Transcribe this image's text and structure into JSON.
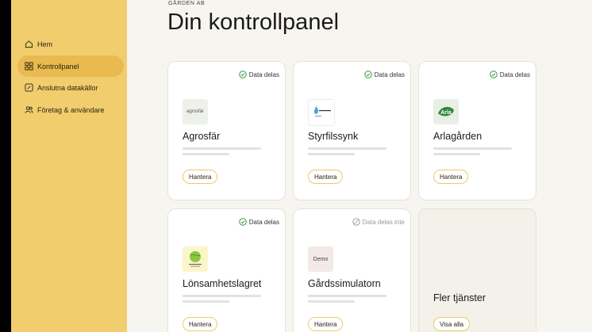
{
  "sidebar": {
    "items": [
      {
        "label": "Hem",
        "icon": "home-icon"
      },
      {
        "label": "Kontrollpanel",
        "icon": "grid-icon",
        "active": true
      },
      {
        "label": "Anslutna datakällor",
        "icon": "link-icon"
      },
      {
        "label": "Företag & användare",
        "icon": "users-icon"
      }
    ]
  },
  "header": {
    "company": "GÅRDEN AB",
    "title": "Din kontrollpanel"
  },
  "cards": [
    {
      "name": "Agrosfär",
      "status": "Data delas",
      "shared": true,
      "logo_text": "agrosfär",
      "button": "Hantera"
    },
    {
      "name": "Styrfilssynk",
      "status": "Data delas",
      "shared": true,
      "logo_text": "",
      "button": "Hantera"
    },
    {
      "name": "Arlagården",
      "status": "Data delas",
      "shared": true,
      "logo_text": "Arla",
      "button": "Hantera"
    },
    {
      "name": "Lönsamhetslagret",
      "status": "Data delas",
      "shared": true,
      "logo_text": "",
      "button": "Hantera"
    },
    {
      "name": "Gårdssimulatorn",
      "status": "Data delas inte",
      "shared": false,
      "logo_text": "Demo",
      "button": "Hantera"
    },
    {
      "name": "Fler tjänster",
      "button": "Visa alla"
    }
  ],
  "colors": {
    "sidebar": "#f2cd6e",
    "sidebar_active": "#e9ba4f",
    "shared_check": "#3a9a3a",
    "button_border": "#efc96a"
  }
}
